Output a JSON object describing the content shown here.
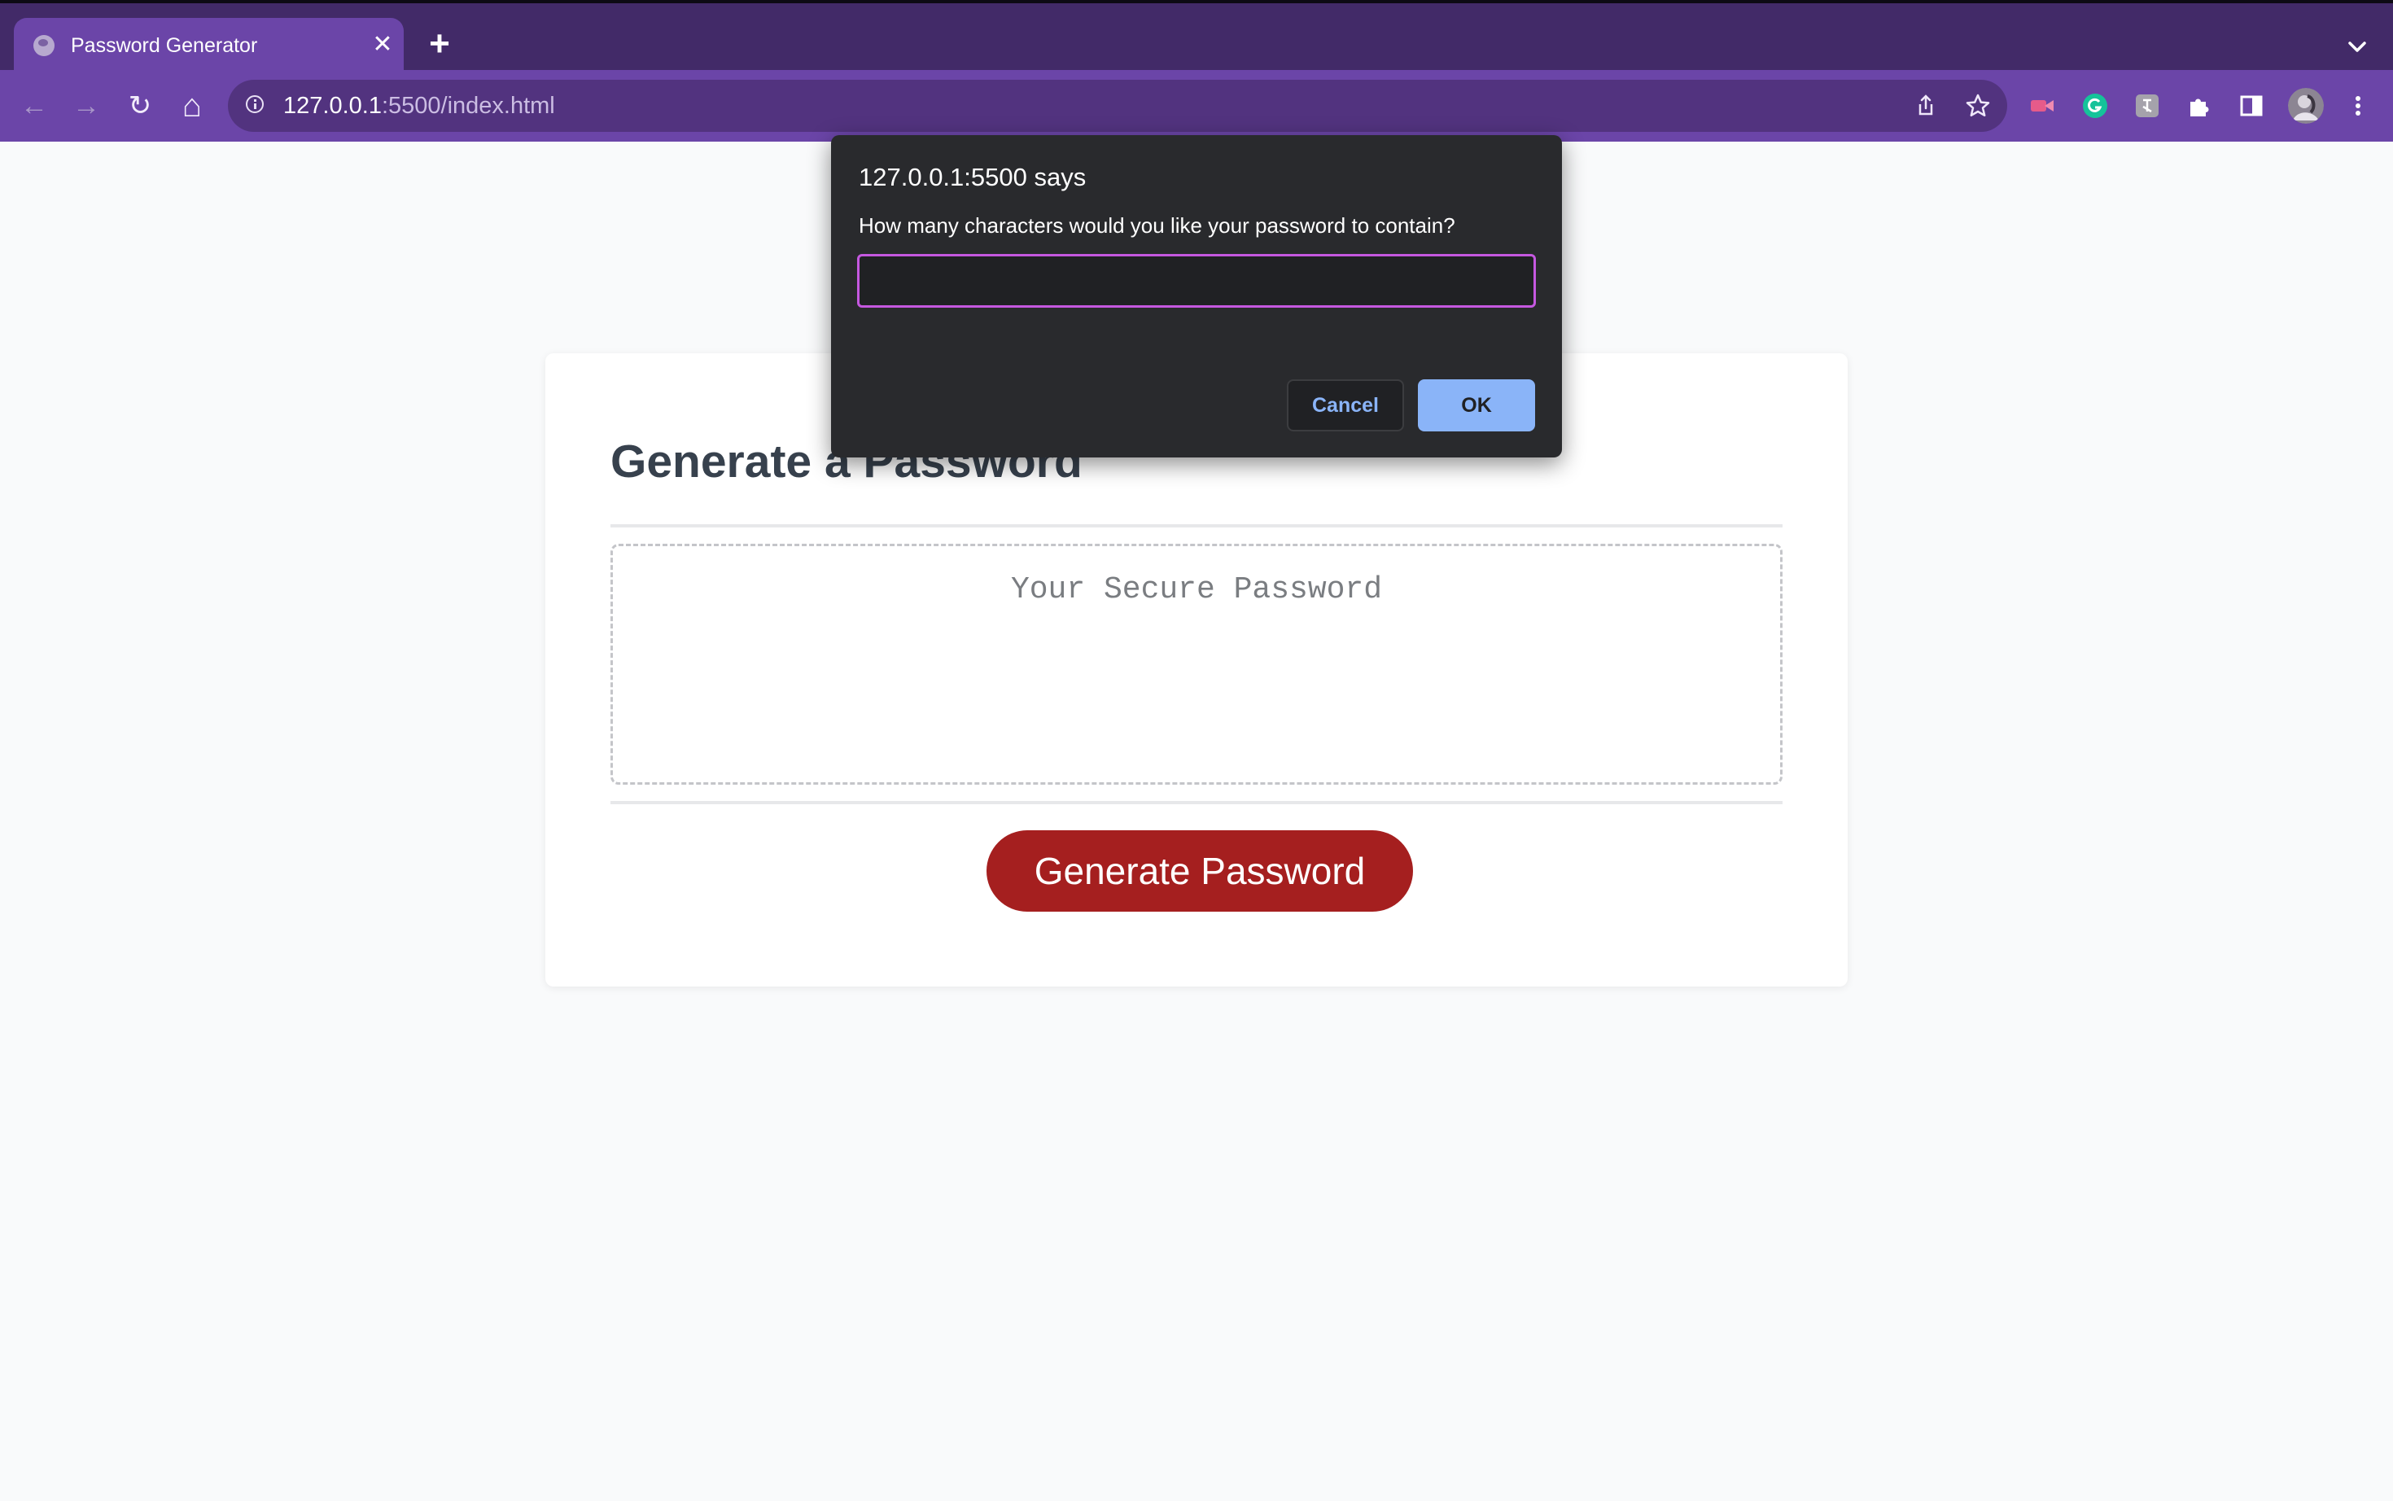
{
  "browser": {
    "tab": {
      "title": "Password Generator",
      "close_glyph": "✕"
    },
    "new_tab_glyph": "+",
    "url": {
      "host": "127.0.0.1",
      "rest": ":5500/index.html"
    },
    "nav": {
      "back": "←",
      "forward": "→",
      "reload": "↻",
      "home": "⌂"
    },
    "icons": [
      "site-info-icon",
      "share-icon",
      "bookmark-star-icon",
      "extensions-icon",
      "side-panel-icon",
      "profile-avatar",
      "menu-kebab-icon"
    ]
  },
  "page": {
    "title": "Generate a Password",
    "password_placeholder": "Your Secure Password",
    "generate_button": "Generate Password"
  },
  "dialog": {
    "title": "127.0.0.1:5500 says",
    "message": "How many characters would you like your password to contain?",
    "input_value": "",
    "cancel_label": "Cancel",
    "ok_label": "OK"
  },
  "colors": {
    "tabstrip": "#422a68",
    "toolbar": "#6b45a8",
    "generate_button": "#a51f1f",
    "dialog_bg": "#292a2d",
    "input_focus": "#c558e0",
    "ok_button": "#8ab4f8"
  }
}
